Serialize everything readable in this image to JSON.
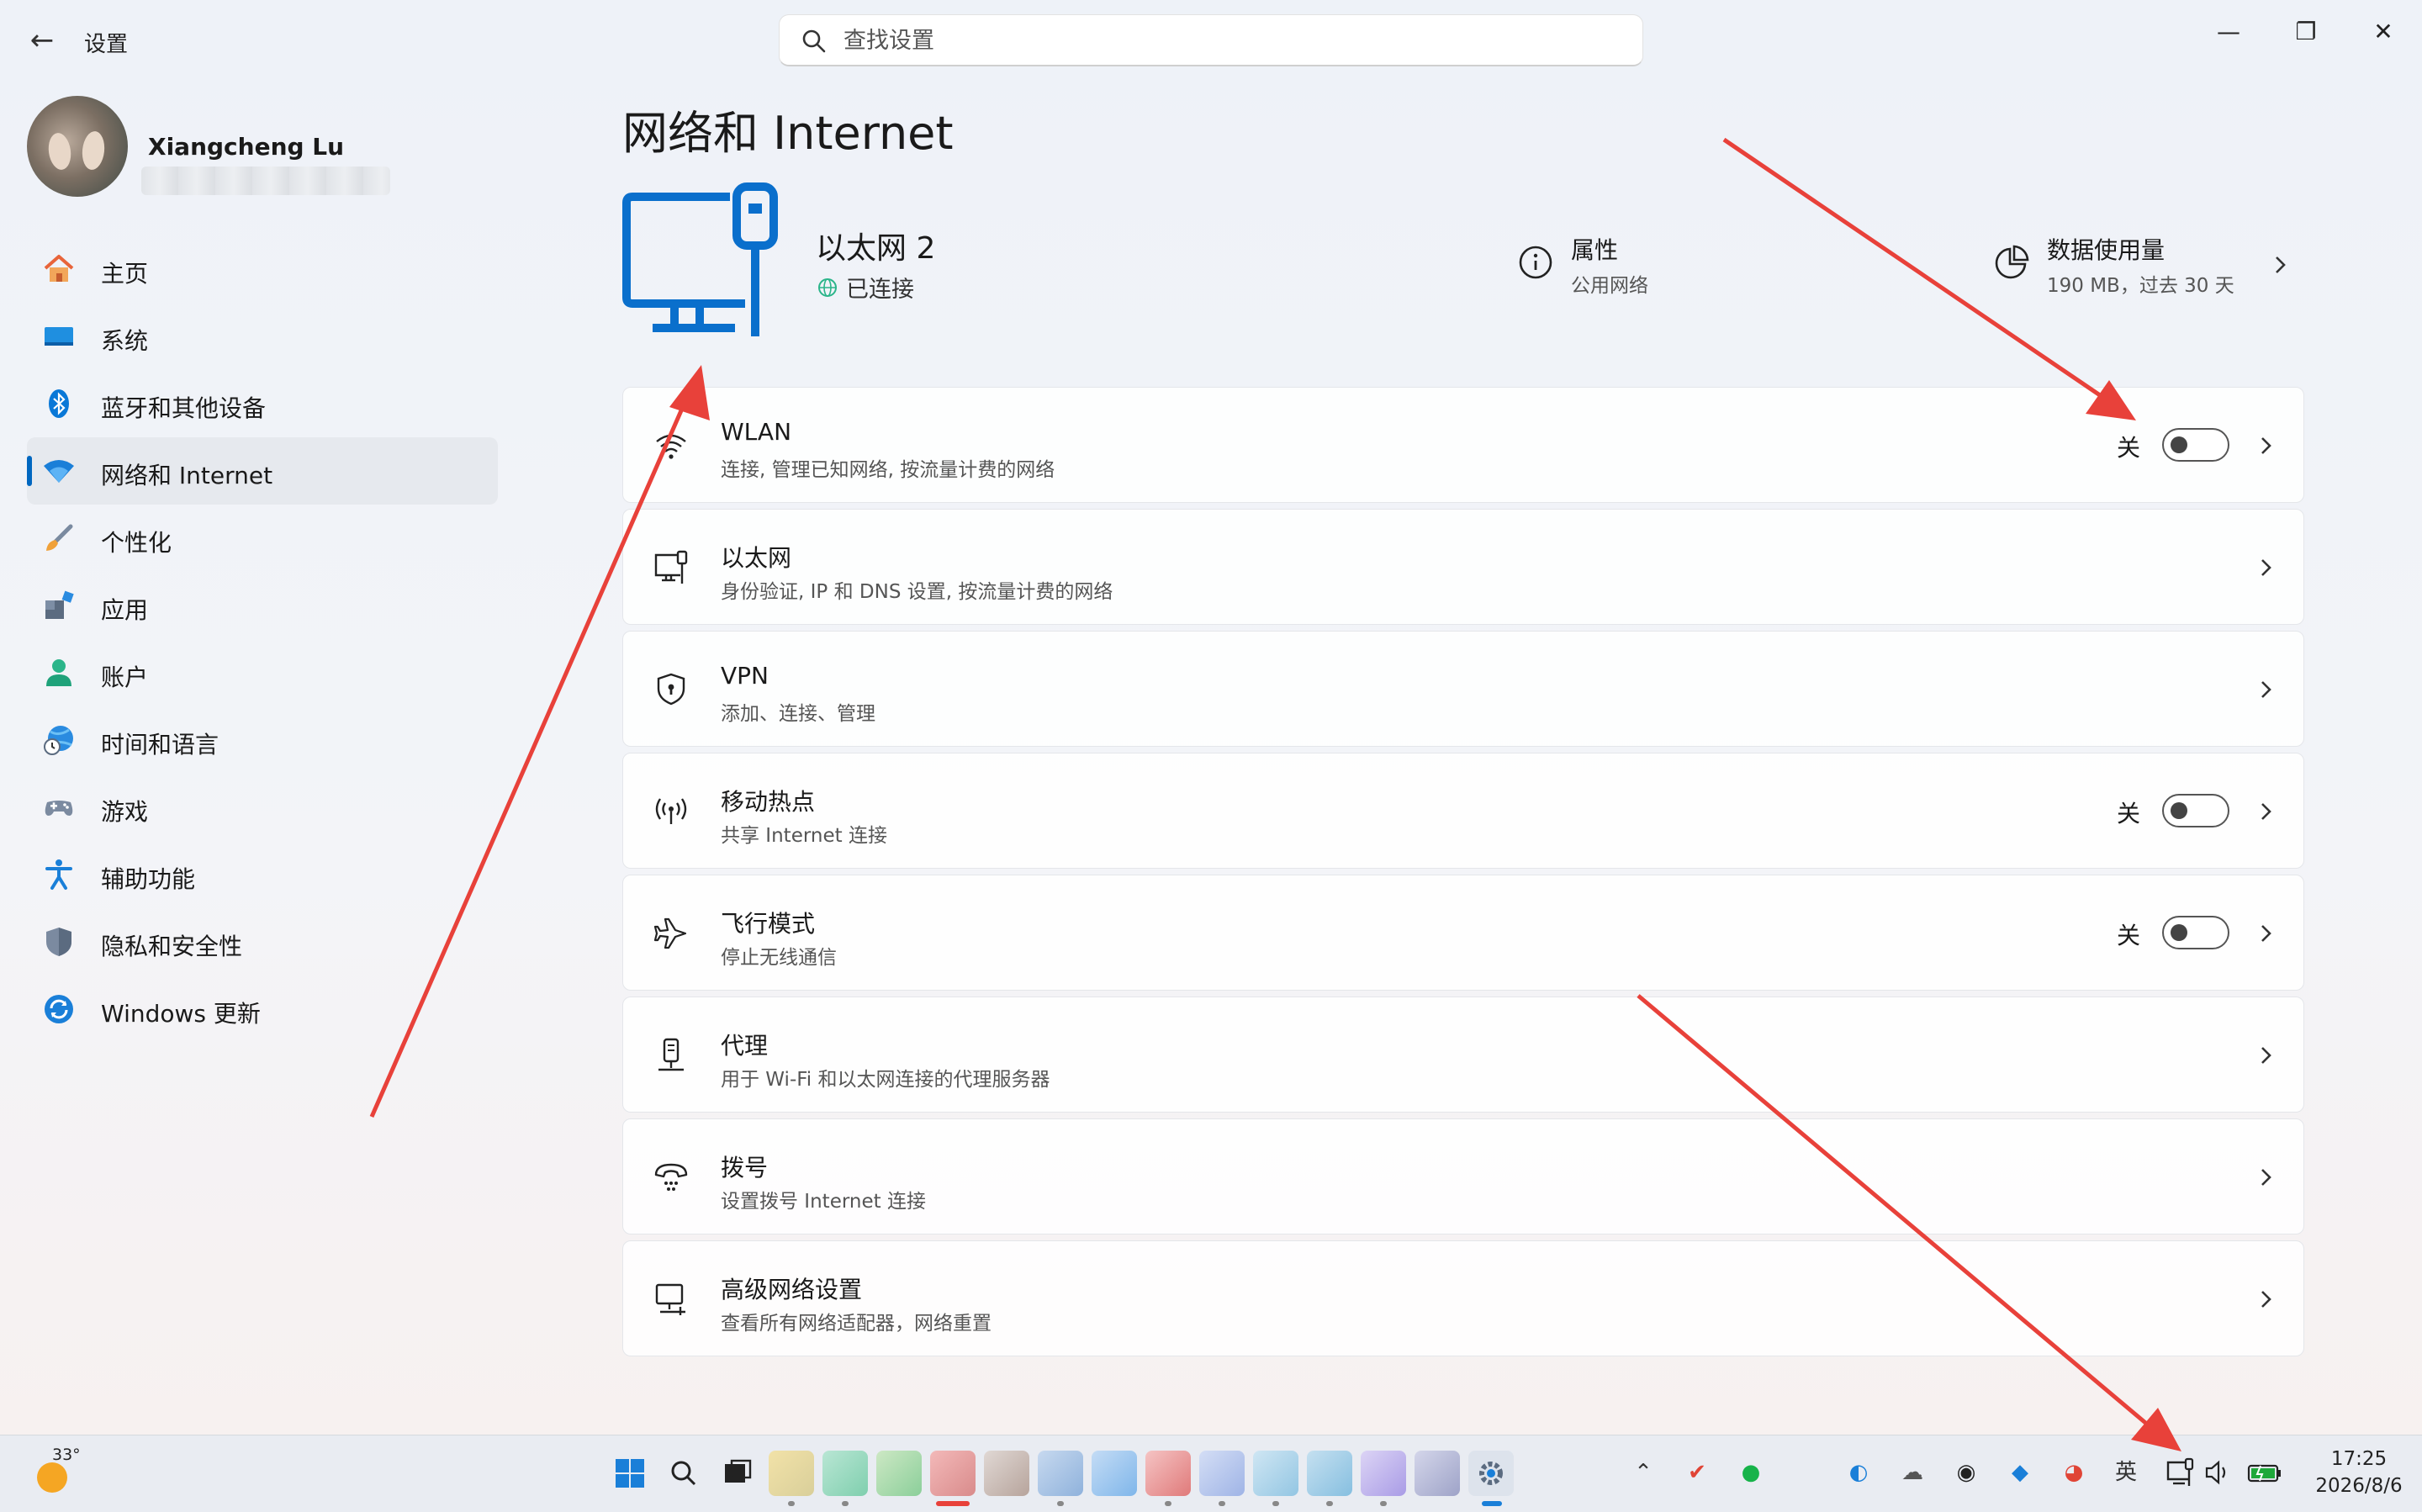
{
  "window": {
    "title": "设置",
    "search_placeholder": "查找设置",
    "controls": {
      "minimize": "—",
      "maximize": "❐",
      "close": "✕"
    }
  },
  "profile": {
    "name": "Xiangcheng Lu"
  },
  "sidebar": {
    "items": [
      {
        "label": "主页",
        "icon": "home-icon",
        "active": false
      },
      {
        "label": "系统",
        "icon": "system-icon",
        "active": false
      },
      {
        "label": "蓝牙和其他设备",
        "icon": "bluetooth-icon",
        "active": false
      },
      {
        "label": "网络和 Internet",
        "icon": "wifi-icon",
        "active": true
      },
      {
        "label": "个性化",
        "icon": "brush-icon",
        "active": false
      },
      {
        "label": "应用",
        "icon": "apps-icon",
        "active": false
      },
      {
        "label": "账户",
        "icon": "account-icon",
        "active": false
      },
      {
        "label": "时间和语言",
        "icon": "globe-clock-icon",
        "active": false
      },
      {
        "label": "游戏",
        "icon": "gamepad-icon",
        "active": false
      },
      {
        "label": "辅助功能",
        "icon": "accessibility-icon",
        "active": false
      },
      {
        "label": "隐私和安全性",
        "icon": "shield-icon",
        "active": false
      },
      {
        "label": "Windows 更新",
        "icon": "update-icon",
        "active": false
      }
    ]
  },
  "main": {
    "page_title": "网络和 Internet",
    "connection": {
      "name": "以太网 2",
      "status": "已连接"
    },
    "properties": {
      "title": "属性",
      "subtitle": "公用网络"
    },
    "data_usage": {
      "title": "数据使用量",
      "subtitle": "190 MB，过去 30 天"
    },
    "cards": [
      {
        "title": "WLAN",
        "subtitle": "连接, 管理已知网络, 按流量计费的网络",
        "icon": "wifi-icon",
        "toggle": "关"
      },
      {
        "title": "以太网",
        "subtitle": "身份验证, IP 和 DNS 设置, 按流量计费的网络",
        "icon": "ethernet-icon"
      },
      {
        "title": "VPN",
        "subtitle": "添加、连接、管理",
        "icon": "vpn-shield-icon"
      },
      {
        "title": "移动热点",
        "subtitle": "共享 Internet 连接",
        "icon": "hotspot-icon",
        "toggle": "关"
      },
      {
        "title": "飞行模式",
        "subtitle": "停止无线通信",
        "icon": "airplane-icon",
        "toggle": "关"
      },
      {
        "title": "代理",
        "subtitle": "用于 Wi-Fi 和以太网连接的代理服务器",
        "icon": "proxy-icon"
      },
      {
        "title": "拨号",
        "subtitle": "设置拨号 Internet 连接",
        "icon": "dialup-icon"
      },
      {
        "title": "高级网络设置",
        "subtitle": "查看所有网络适配器，网络重置",
        "icon": "advanced-network-icon"
      }
    ]
  },
  "taskbar": {
    "weather_temp": "33°",
    "tray_ime": "英",
    "clock_time": "17:25",
    "clock_date": "2026/8/6"
  },
  "colors": {
    "accent": "#0067c0",
    "arrow": "#e8413a"
  }
}
